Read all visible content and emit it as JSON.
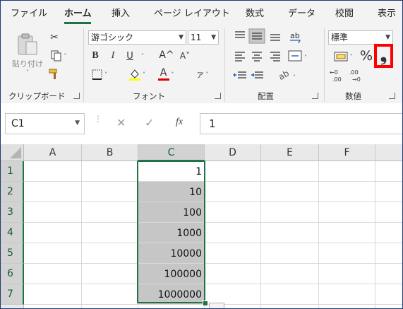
{
  "tabs": [
    "ファイル",
    "ホーム",
    "挿入",
    "ページ レイアウト",
    "数式",
    "データ",
    "校閲",
    "表示"
  ],
  "active_tab": "ホーム",
  "clipboard": {
    "paste_label": "貼り付け",
    "group_label": "クリップボード"
  },
  "font": {
    "name": "游ゴシック",
    "size": "11",
    "bold": "B",
    "italic": "I",
    "underline": "U",
    "grow": "A^",
    "shrink": "A˅",
    "color_letter": "A",
    "phonetic": "ア",
    "group_label": "フォント"
  },
  "alignment": {
    "group_label": "配置"
  },
  "number": {
    "format": "標準",
    "percent": "%",
    "comma": "❟",
    "group_label": "数値"
  },
  "formula_bar": {
    "name_box": "C1",
    "fx": "fx",
    "value": "1"
  },
  "columns": [
    "A",
    "B",
    "C",
    "D",
    "E",
    "F"
  ],
  "rows": [
    "1",
    "2",
    "3",
    "4",
    "5",
    "6",
    "7"
  ],
  "cells_C": [
    "1",
    "10",
    "100",
    "1000",
    "10000",
    "100000",
    "1000000"
  ],
  "colors": {
    "accent": "#217346",
    "highlight_box": "#ff0000"
  }
}
